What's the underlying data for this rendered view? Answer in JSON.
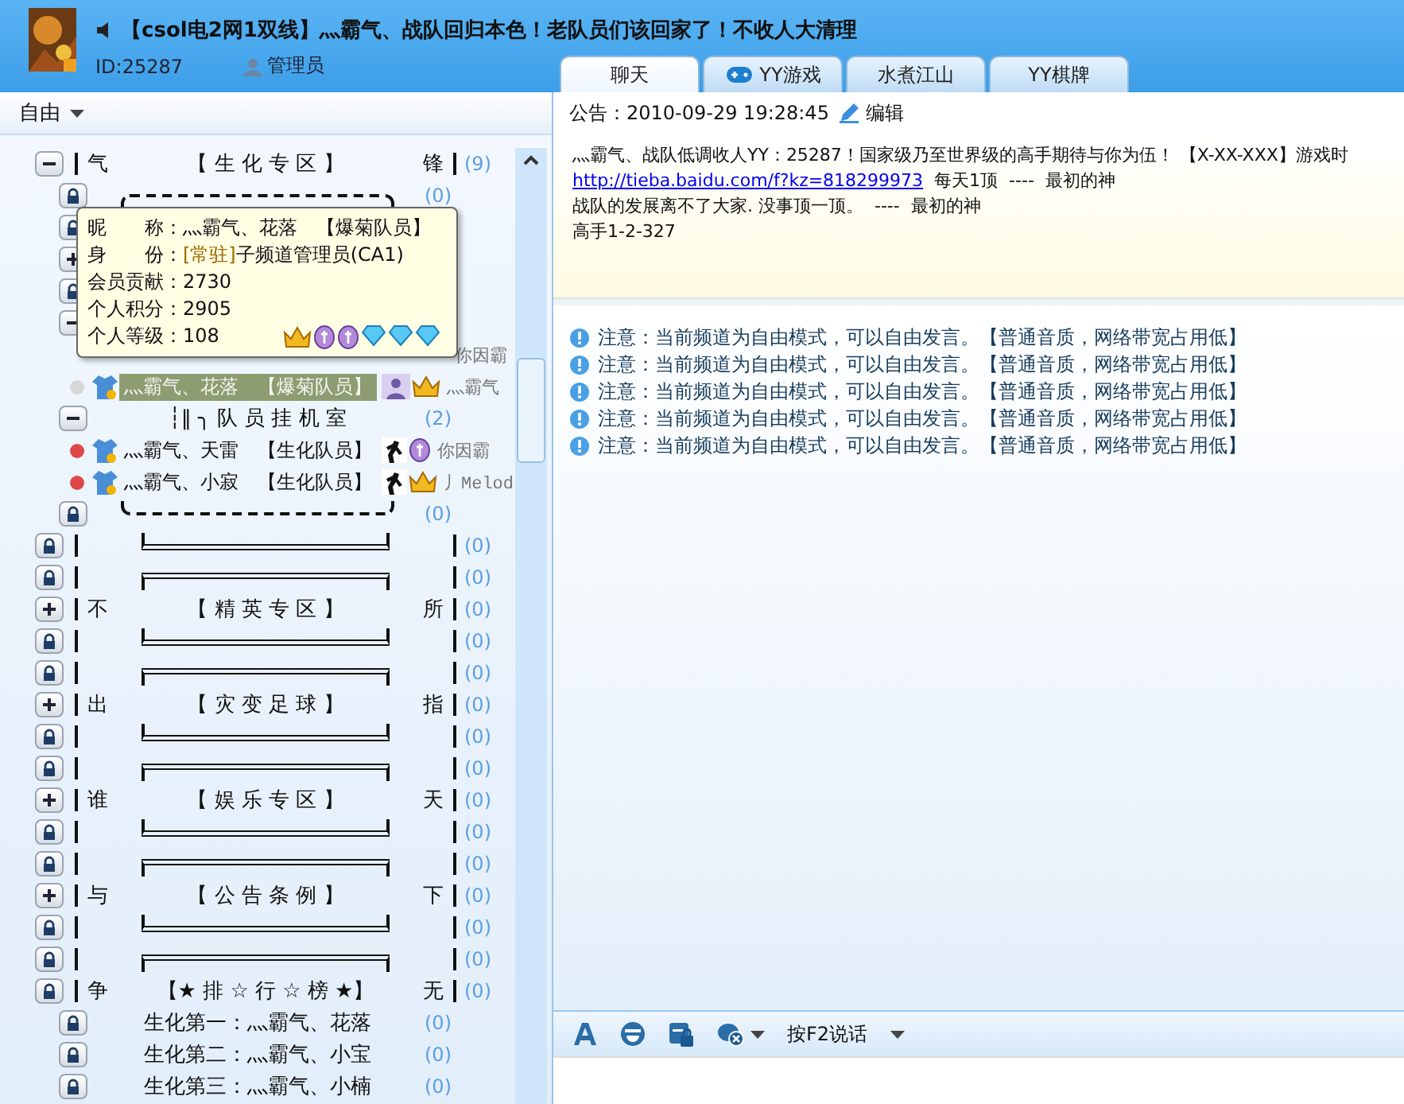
{
  "header": {
    "title": "【csol电2网1双线】灬霸气、战队回归本色！老队员们该回家了！不收人大清理",
    "id": "ID:25287",
    "role": "管理员"
  },
  "tabs": [
    {
      "label": "聊天",
      "selected": true,
      "kind": "plain"
    },
    {
      "label": "YY游戏",
      "selected": false,
      "kind": "game"
    },
    {
      "label": "水煮江山",
      "selected": false,
      "kind": "plain"
    },
    {
      "label": "YY棋牌",
      "selected": false,
      "kind": "plain"
    }
  ],
  "mode": "自由",
  "tree": [
    {
      "kind": "channel",
      "expanded": true,
      "left": "气",
      "name": "【 生 化 专 区 】",
      "right": "锋",
      "count": "(9)",
      "children": [
        {
          "kind": "frame-top",
          "count": "(0)"
        },
        {
          "kind": "locked"
        },
        {
          "kind": "channel",
          "expanded": false
        },
        {
          "kind": "locked"
        },
        {
          "kind": "channel",
          "expanded": true,
          "children": [
            {
              "kind": "user",
              "status": "你因霸"
            },
            {
              "kind": "user",
              "color": "#d8d8d8",
              "name": "灬霸气、花落",
              "tag": "【爆菊队员】",
              "status": "灬霸气",
              "selected": true
            }
          ]
        },
        {
          "kind": "channel",
          "expanded": true,
          "name": "┆‖ ╮ 队 员 挂 机 室",
          "count": "(2)",
          "children": [
            {
              "kind": "user",
              "color": "#e04848",
              "name": "灬霸气、天雷",
              "tag": "【生化队员】",
              "status": "你因霸",
              "selected": false
            },
            {
              "kind": "user",
              "color": "#e04848",
              "name": "灬霸气、小寂",
              "tag": "【生化队员】",
              "status": "丿Melod",
              "selected": false
            }
          ]
        },
        {
          "kind": "frame-bottom",
          "count": "(0)"
        }
      ]
    },
    {
      "kind": "frame-bottom",
      "count": "(0)"
    },
    {
      "kind": "frame-top",
      "count": "(0)"
    },
    {
      "kind": "channel",
      "expanded": false,
      "left": "不",
      "name": "【 精 英 专 区 】",
      "right": "所",
      "count": "(0)"
    },
    {
      "kind": "frame-bottom",
      "count": "(0)"
    },
    {
      "kind": "frame-top",
      "count": "(0)"
    },
    {
      "kind": "channel",
      "expanded": false,
      "left": "出",
      "name": "【 灾 变 足 球 】",
      "right": "指",
      "count": "(0)"
    },
    {
      "kind": "frame-bottom",
      "count": "(0)"
    },
    {
      "kind": "frame-top",
      "count": "(0)"
    },
    {
      "kind": "channel",
      "expanded": false,
      "left": "谁",
      "name": "【 娱 乐 专 区 】",
      "right": "天",
      "count": "(0)"
    },
    {
      "kind": "frame-bottom",
      "count": "(0)"
    },
    {
      "kind": "frame-top",
      "count": "(0)"
    },
    {
      "kind": "channel",
      "expanded": false,
      "left": "与",
      "name": "【 公 告 条 例 】",
      "right": "下",
      "count": "(0)"
    },
    {
      "kind": "frame-bottom",
      "count": "(0)"
    },
    {
      "kind": "frame-top",
      "count": "(0)"
    },
    {
      "kind": "locked",
      "left": "争",
      "name": "【★ 排 ☆ 行 ☆ 榜 ★】",
      "right": "无",
      "count": "(0)",
      "children": [
        {
          "kind": "locked",
          "name": "生化第一：灬霸气、花落",
          "count": "(0)"
        },
        {
          "kind": "locked",
          "name": "生化第二：灬霸气、小宝",
          "count": "(0)"
        },
        {
          "kind": "locked",
          "name": "生化第三：灬霸气、小楠",
          "count": "(0)"
        }
      ]
    }
  ],
  "tooltip": {
    "rows": [
      {
        "label": "昵　　称：",
        "value": "灬霸气、花落　【爆菊队员】"
      },
      {
        "label": "身　　份：",
        "tag": "[常驻]",
        "value": "子频道管理员(CA1)"
      },
      {
        "label": "会员贡献：",
        "value": "2730"
      },
      {
        "label": "个人积分：",
        "value": "2905"
      },
      {
        "label": "个人等级：",
        "value": "108",
        "kind": "level"
      }
    ]
  },
  "notice": {
    "label": "公告：",
    "time": "2010-09-29 19:28:45",
    "edit": "编辑"
  },
  "announcement": [
    {
      "text": "灬霸气、战队低调收人YY：25287！国家级乃至世界级的高手期待与你为伍！ 【X-XX-XXX】游戏时"
    },
    {
      "link": "http://tieba.baidu.com/f?kz=818299973",
      "text": "  每天1顶  ----  最初的神"
    },
    {
      "text": "战队的发展离不了大家. 没事顶一顶。  ----  最初的神"
    },
    {
      "text": "高手1-2-327"
    }
  ],
  "messages": [
    "注意：当前频道为自由模式，可以自由发言。【普通音质，网络带宽占用低】",
    "注意：当前频道为自由模式，可以自由发言。【普通音质，网络带宽占用低】",
    "注意：当前频道为自由模式，可以自由发言。【普通音质，网络带宽占用低】",
    "注意：当前频道为自由模式，可以自由发言。【普通音质，网络带宽占用低】",
    "注意：当前频道为自由模式，可以自由发言。【普通音质，网络带宽占用低】"
  ],
  "toolbar": {
    "talk": "按F2说话"
  }
}
